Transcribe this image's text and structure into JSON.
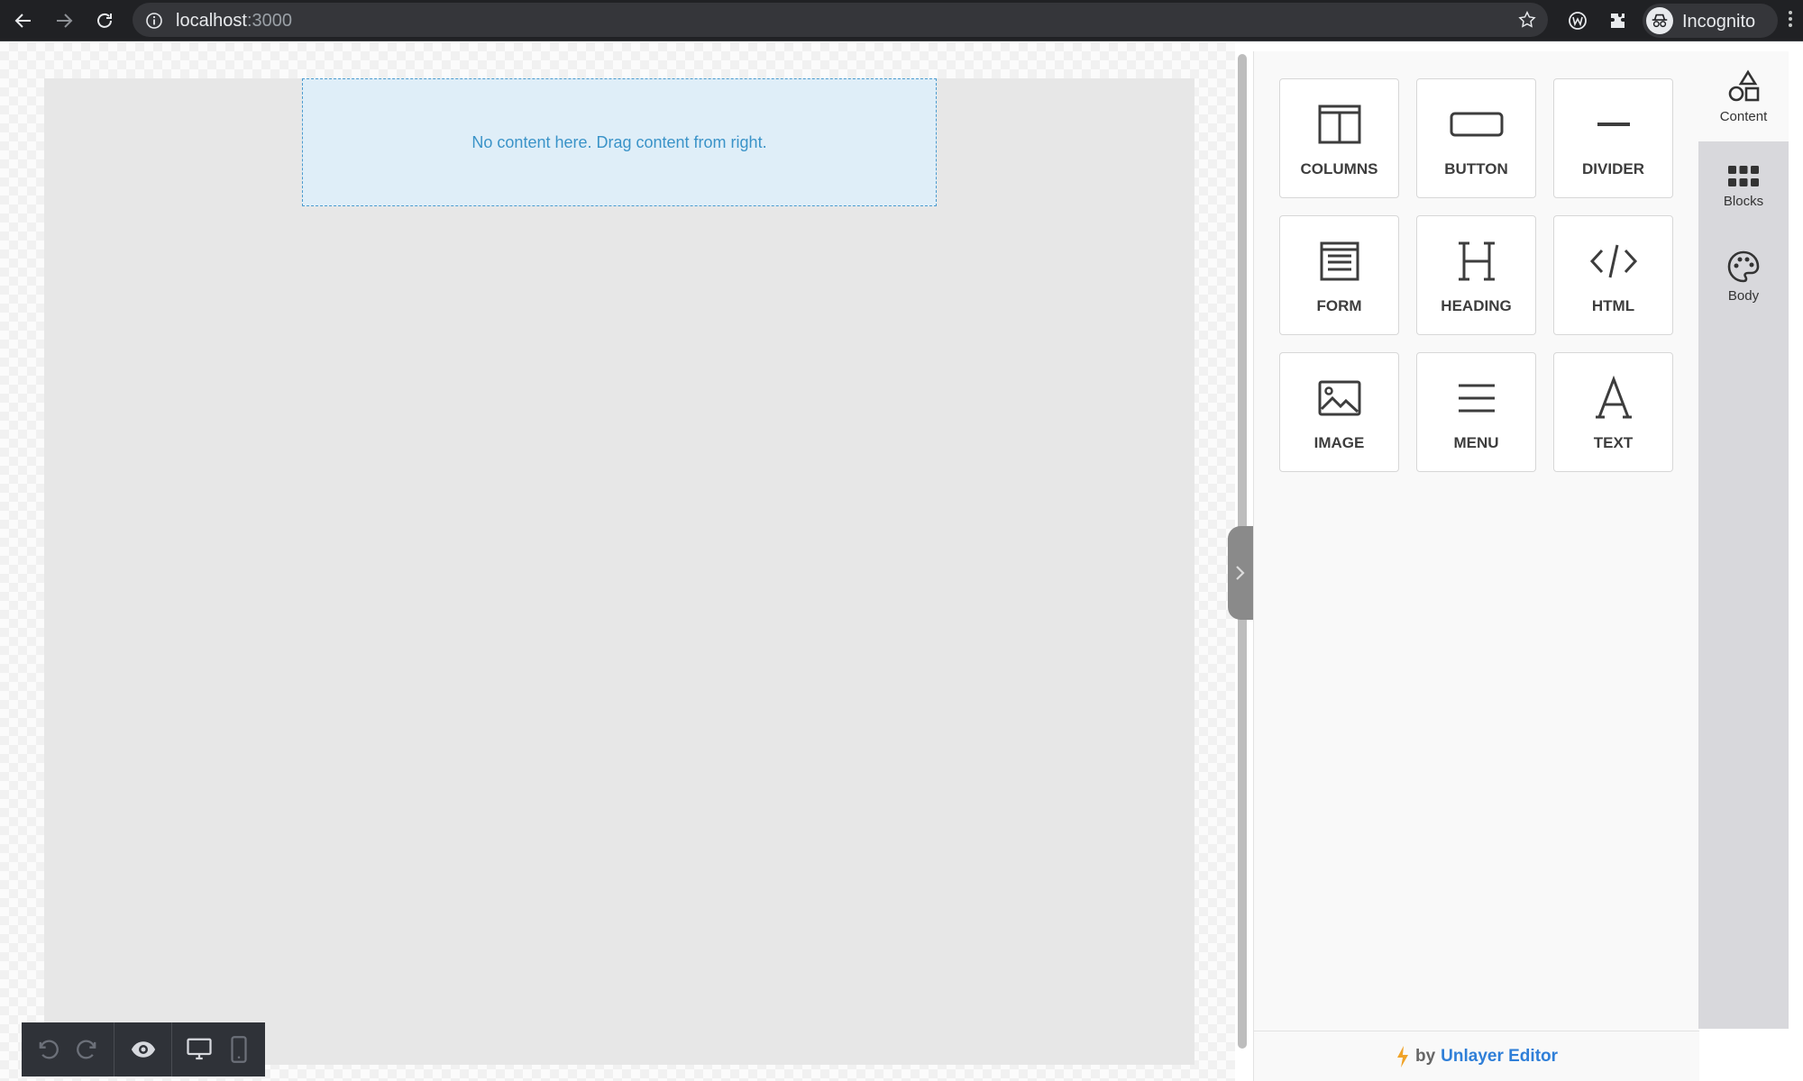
{
  "browser": {
    "url_host": "localhost",
    "url_port": ":3000",
    "profile_label": "Incognito"
  },
  "canvas": {
    "empty_message": "No content here. Drag content from right."
  },
  "tools": [
    {
      "label": "COLUMNS",
      "icon": "columns-icon"
    },
    {
      "label": "BUTTON",
      "icon": "button-icon"
    },
    {
      "label": "DIVIDER",
      "icon": "divider-icon"
    },
    {
      "label": "FORM",
      "icon": "form-icon"
    },
    {
      "label": "HEADING",
      "icon": "heading-icon"
    },
    {
      "label": "HTML",
      "icon": "code-icon"
    },
    {
      "label": "IMAGE",
      "icon": "image-icon"
    },
    {
      "label": "MENU",
      "icon": "menu-icon"
    },
    {
      "label": "TEXT",
      "icon": "text-icon"
    }
  ],
  "side_tabs": [
    {
      "label": "Content",
      "icon": "shapes-icon",
      "active": true
    },
    {
      "label": "Blocks",
      "icon": "grid-icon",
      "active": false
    },
    {
      "label": "Body",
      "icon": "palette-icon",
      "active": false
    }
  ],
  "footer": {
    "by": "by",
    "brand": "Unlayer Editor"
  },
  "colors": {
    "accent": "#2f7fd8",
    "drop_zone_text": "#3a93c8",
    "toolbar_bg": "#2f3238"
  }
}
